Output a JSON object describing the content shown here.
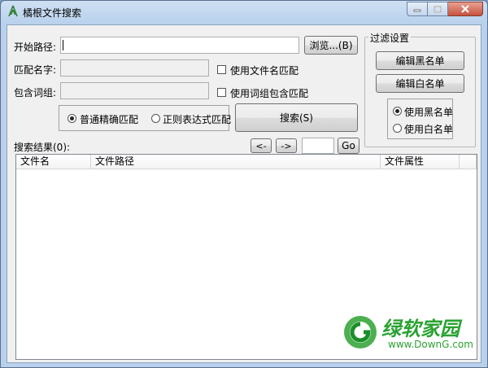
{
  "window": {
    "title": "橘根文件搜索"
  },
  "form": {
    "start_path_label": "开始路径:",
    "browse_button": "浏览...(B)",
    "match_name_label": "匹配名字:",
    "use_filename_match": "使用文件名匹配",
    "contains_words_label": "包含词组:",
    "use_words_match": "使用词组包含匹配",
    "mode_normal": "普通精确匹配",
    "mode_regex": "正则表达式匹配",
    "mode_selected": "normal",
    "search_button": "搜索(S)"
  },
  "filter": {
    "title": "过滤设置",
    "edit_blacklist": "编辑黑名单",
    "edit_whitelist": "编辑白名单",
    "use_blacklist": "使用黑名单",
    "use_whitelist": "使用白名单",
    "selected": "blacklist"
  },
  "results": {
    "label": "搜索结果(0):",
    "prev": "<-",
    "next": "->",
    "page_value": "",
    "go": "Go",
    "columns": [
      "文件名",
      "文件路径",
      "文件属性"
    ]
  },
  "watermark": {
    "brand": "绿软家园",
    "url": "www.DownG.com"
  }
}
